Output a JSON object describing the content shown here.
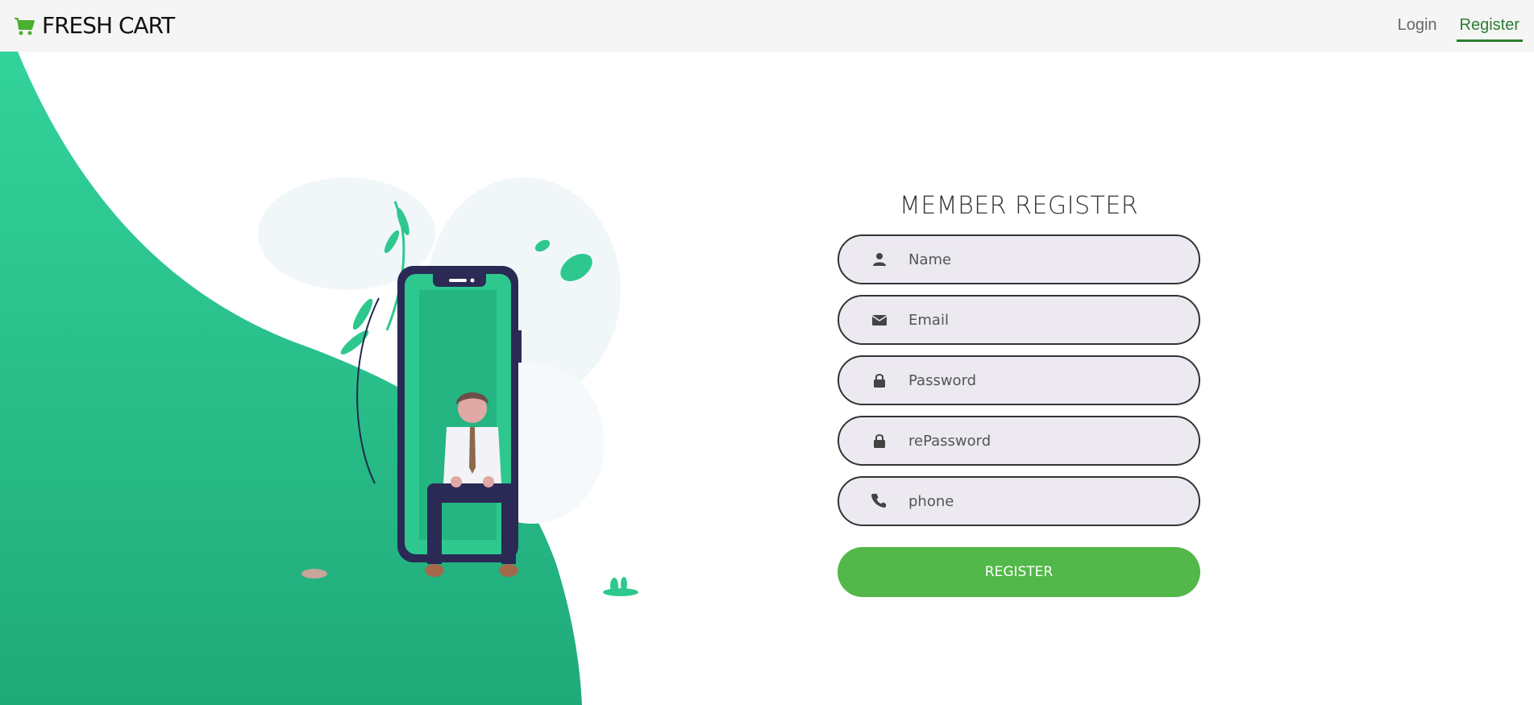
{
  "nav": {
    "brand": "FRESH CART",
    "login": "Login",
    "register": "Register"
  },
  "form": {
    "title": "MEMBER REGISTER",
    "fields": [
      {
        "placeholder": "Name",
        "icon": "user-icon"
      },
      {
        "placeholder": "Email",
        "icon": "envelope-icon"
      },
      {
        "placeholder": "Password",
        "icon": "lock-icon"
      },
      {
        "placeholder": "rePassword",
        "icon": "lock-icon"
      },
      {
        "placeholder": "phone",
        "icon": "phone-icon"
      }
    ],
    "submit": "REGISTER"
  },
  "colors": {
    "brand_green": "#4caf2e",
    "wave_green": "#2ec88f",
    "button_green": "#52b849",
    "input_bg": "#eceaf0",
    "active_link": "#2e7d32"
  }
}
